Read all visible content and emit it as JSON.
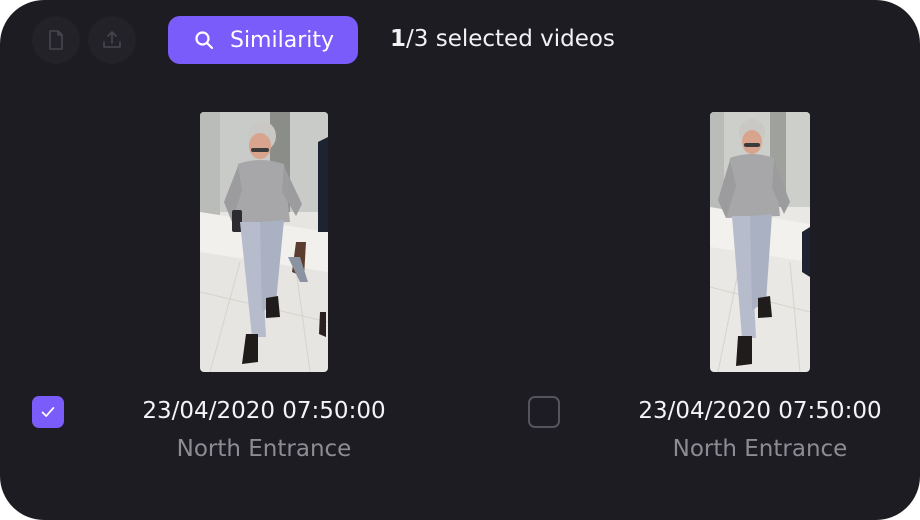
{
  "toolbar": {
    "document_icon": "file-icon",
    "export_icon": "upload-icon",
    "similarity_label": "Similarity",
    "selected_count": "1",
    "selected_total_text": "/3 selected videos"
  },
  "videos": [
    {
      "timestamp": "23/04/2020 07:50:00",
      "location": "North Entrance",
      "selected": true
    },
    {
      "timestamp": "23/04/2020 07:50:00",
      "location": "North Entrance",
      "selected": false
    }
  ],
  "colors": {
    "accent": "#7a5cfa",
    "background": "#1d1c23"
  }
}
